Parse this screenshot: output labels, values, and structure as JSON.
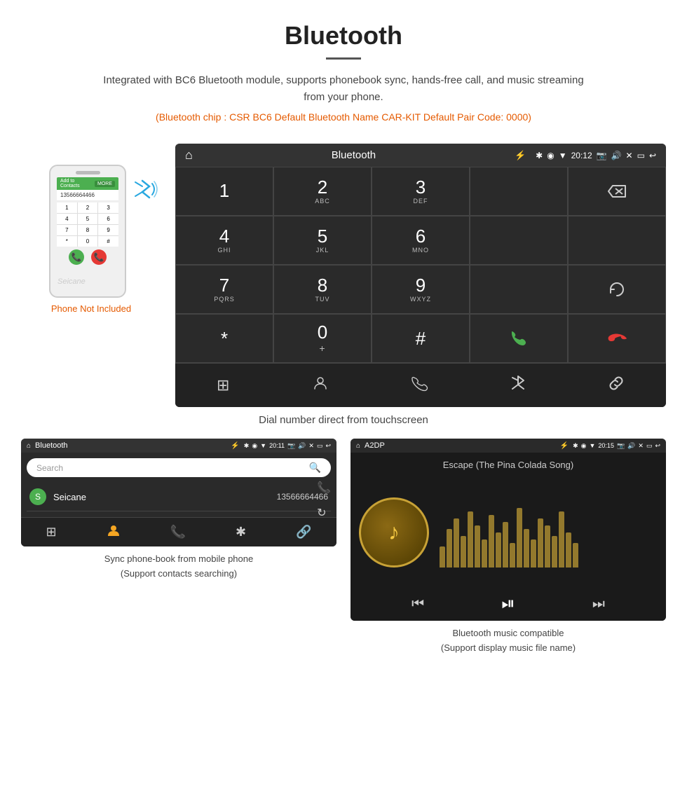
{
  "header": {
    "title": "Bluetooth",
    "description": "Integrated with BC6 Bluetooth module, supports phonebook sync, hands-free call, and music streaming from your phone.",
    "specs": "(Bluetooth chip : CSR BC6    Default Bluetooth Name CAR-KIT    Default Pair Code: 0000)"
  },
  "phone": {
    "not_included": "Phone Not Included",
    "screen_label": "Add to Contacts",
    "screen_number": "MORE"
  },
  "car_screen": {
    "status_bar": {
      "title": "Bluetooth",
      "time": "20:12",
      "usb_icon": "⚡",
      "home_icon": "⌂"
    },
    "dialpad": [
      {
        "num": "1",
        "sub": ""
      },
      {
        "num": "2",
        "sub": "ABC"
      },
      {
        "num": "3",
        "sub": "DEF"
      },
      {
        "num": "",
        "sub": ""
      },
      {
        "num": "⌫",
        "sub": ""
      },
      {
        "num": "4",
        "sub": "GHI"
      },
      {
        "num": "5",
        "sub": "JKL"
      },
      {
        "num": "6",
        "sub": "MNO"
      },
      {
        "num": "",
        "sub": ""
      },
      {
        "num": "",
        "sub": ""
      },
      {
        "num": "7",
        "sub": "PQRS"
      },
      {
        "num": "8",
        "sub": "TUV"
      },
      {
        "num": "9",
        "sub": "WXYZ"
      },
      {
        "num": "",
        "sub": ""
      },
      {
        "num": "↻",
        "sub": ""
      },
      {
        "num": "*",
        "sub": ""
      },
      {
        "num": "0",
        "sub": "+"
      },
      {
        "num": "#",
        "sub": ""
      },
      {
        "num": "📞",
        "sub": ""
      },
      {
        "num": "📞",
        "sub": ""
      }
    ],
    "bottom_nav": [
      "⊞",
      "👤",
      "📞",
      "✱",
      "🔗"
    ]
  },
  "caption_dial": "Dial number direct from touchscreen",
  "phonebook_screen": {
    "status_bar": {
      "home": "⌂",
      "title": "Bluetooth",
      "usb": "⚡",
      "time": "20:11"
    },
    "search_placeholder": "Search",
    "contact": {
      "initial": "S",
      "name": "Seicane",
      "number": "13566664466"
    },
    "bottom_nav": [
      "⊞",
      "👤",
      "📞",
      "✱",
      "🔗"
    ]
  },
  "music_screen": {
    "status_bar": {
      "home": "⌂",
      "title": "A2DP",
      "usb": "⚡",
      "time": "20:15"
    },
    "song_title": "Escape (The Pina Colada Song)",
    "eq_bars": [
      30,
      55,
      70,
      45,
      80,
      60,
      40,
      75,
      50,
      65,
      35,
      85,
      55,
      40,
      70,
      60,
      45,
      80,
      50,
      35
    ]
  },
  "caption_phonebook": "Sync phone-book from mobile phone\n(Support contacts searching)",
  "caption_music": "Bluetooth music compatible\n(Support display music file name)"
}
